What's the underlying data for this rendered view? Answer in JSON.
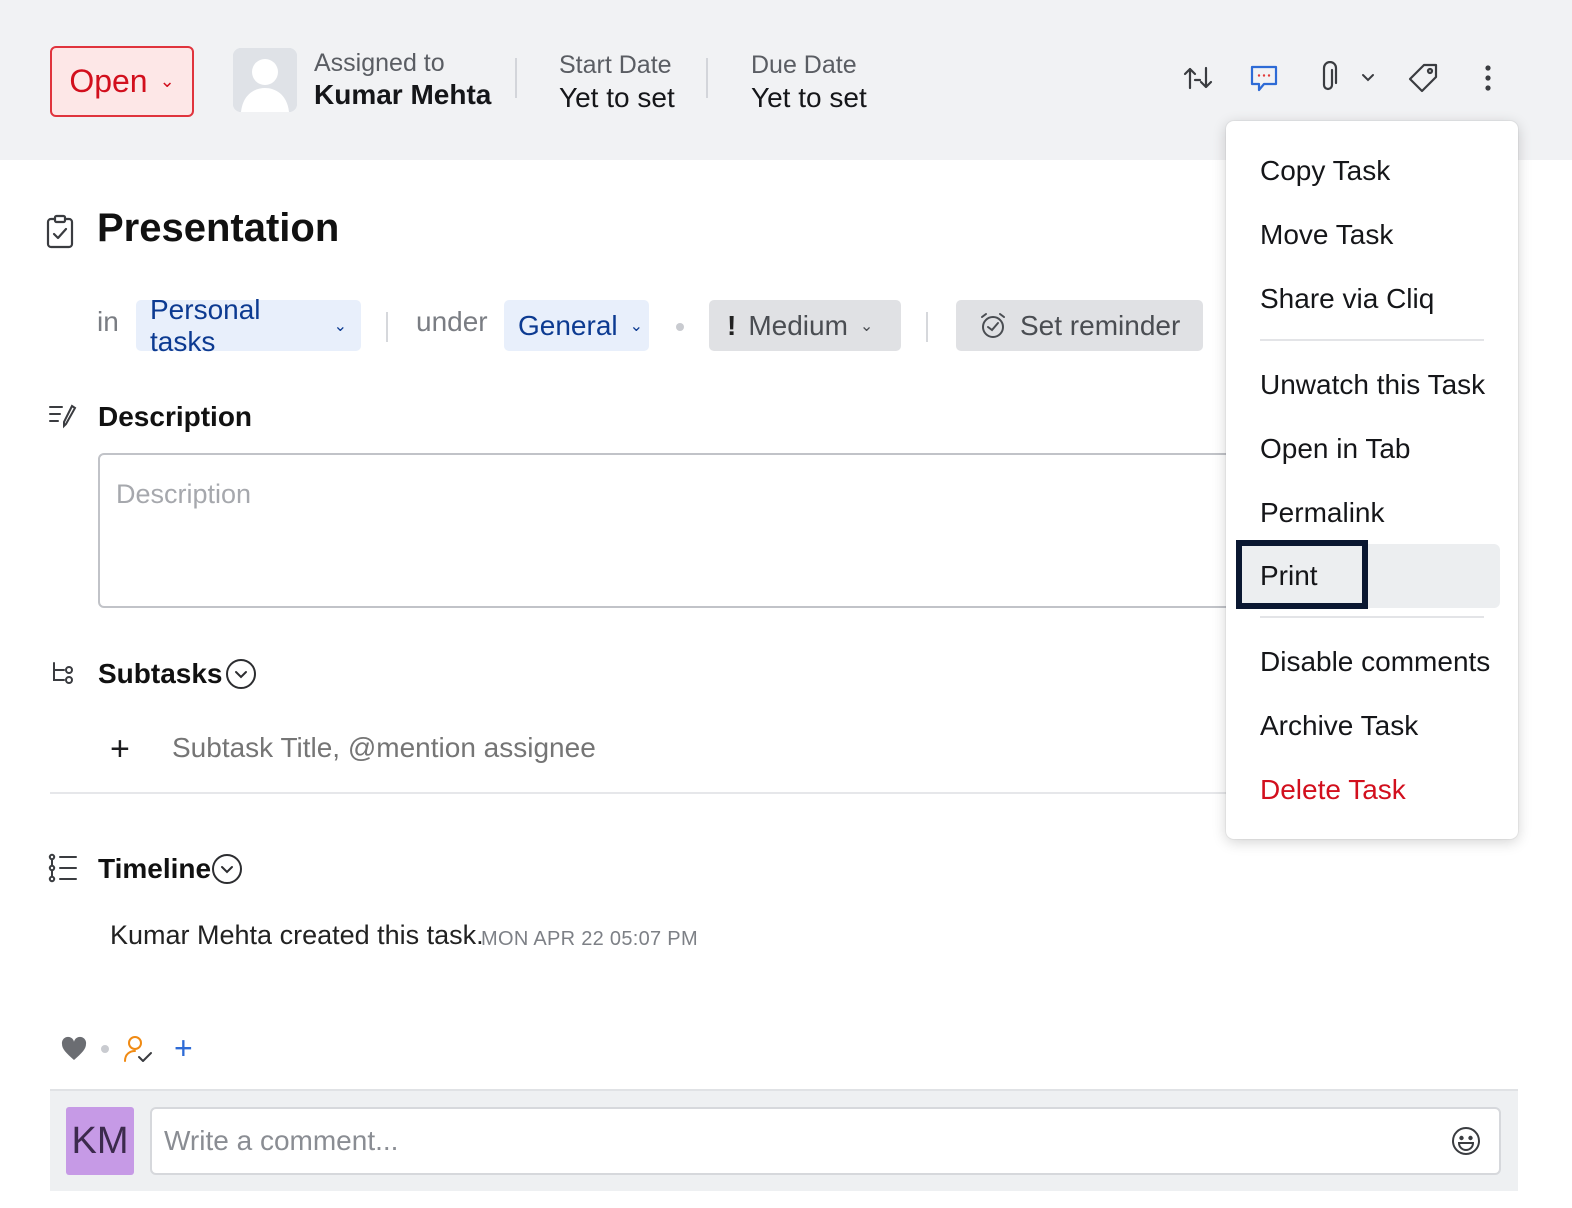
{
  "header": {
    "status": "Open",
    "assigned_label": "Assigned to",
    "assignee": "Kumar Mehta",
    "start_label": "Start Date",
    "start_value": "Yet to set",
    "due_label": "Due Date",
    "due_value": "Yet to set",
    "icons": [
      "convert-icon",
      "comment-icon",
      "attachment-icon",
      "chevron-down-icon",
      "tag-icon",
      "more-vertical-icon"
    ]
  },
  "task": {
    "title": "Presentation",
    "in_label": "in",
    "project": "Personal tasks",
    "under_label": "under",
    "tasklist": "General",
    "priority_symbol": "!",
    "priority": "Medium",
    "reminder": "Set reminder"
  },
  "description": {
    "heading": "Description",
    "placeholder": "Description"
  },
  "subtasks": {
    "heading": "Subtasks",
    "plus": "+",
    "placeholder": "Subtask Title, @mention assignee"
  },
  "timeline": {
    "heading": "Timeline",
    "actor": "Kumar Mehta",
    "action": " created this task.",
    "time": "MON APR 22 05:07 PM"
  },
  "reactions": {
    "plus": "+"
  },
  "comment": {
    "avatar_initials": "KM",
    "placeholder": "Write a comment...",
    "avatar_color": "#c69ae6"
  },
  "menu": {
    "items": [
      {
        "label": "Copy Task"
      },
      {
        "label": "Move Task"
      },
      {
        "label": "Share via Cliq"
      },
      {
        "label": "Unwatch this Task"
      },
      {
        "label": "Open in Tab"
      },
      {
        "label": "Permalink"
      },
      {
        "label": "Print"
      },
      {
        "label": "Disable comments"
      },
      {
        "label": "Archive Task"
      },
      {
        "label": "Delete Task"
      }
    ],
    "highlighted": "Print"
  },
  "colors": {
    "status_red": "#d20f1d",
    "link_blue": "#0c3a91",
    "accent_blue": "#2e6bd6",
    "danger": "#d20f1d"
  }
}
